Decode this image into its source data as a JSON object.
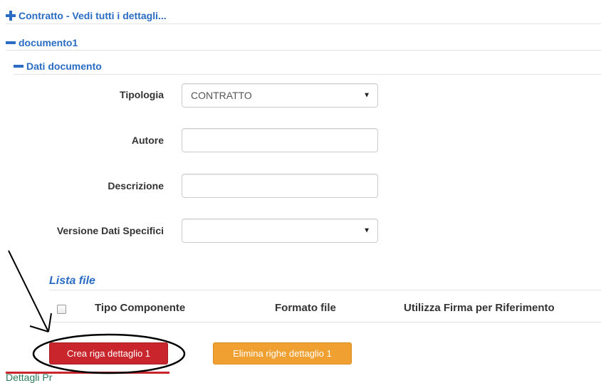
{
  "sections": {
    "contratto": {
      "title": "Contratto - Vedi tutti i dettagli..."
    },
    "documento": {
      "title": "documento1"
    },
    "dati_documento": {
      "title": "Dati documento"
    }
  },
  "form": {
    "tipologia": {
      "label": "Tipologia",
      "value": "CONTRATTO"
    },
    "autore": {
      "label": "Autore",
      "value": ""
    },
    "descrizione": {
      "label": "Descrizione",
      "value": ""
    },
    "versione": {
      "label": "Versione Dati Specifici",
      "value": ""
    }
  },
  "lista_file": {
    "title": "Lista file",
    "columns": [
      "Tipo Componente",
      "Formato file",
      "Utilizza Firma per Riferimento"
    ]
  },
  "buttons": {
    "crea": "Crea riga dettaglio 1",
    "elimina": "Elimina righe dettaglio 1"
  },
  "footer": {
    "partial_text": "Dettagli Pr"
  },
  "colors": {
    "link_blue": "#2a6cc4",
    "button_red": "#c9252c",
    "button_orange": "#f0a030"
  },
  "icons": [
    "plus-icon",
    "minus-icon",
    "dropdown-caret-icon",
    "arrow-annotation",
    "ellipse-annotation"
  ]
}
